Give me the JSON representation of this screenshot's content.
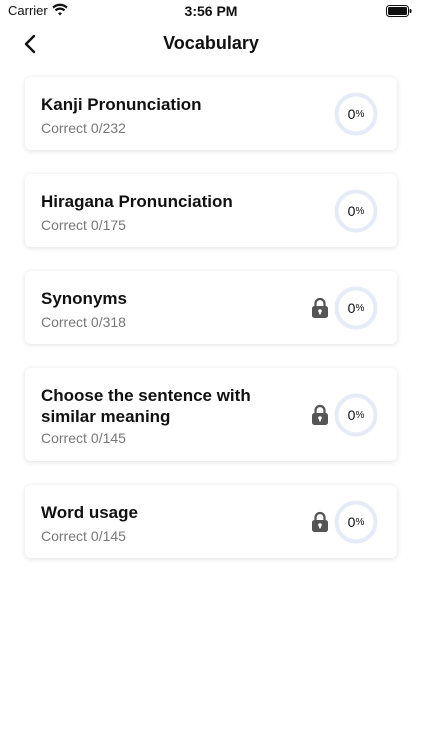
{
  "status_bar": {
    "carrier": "Carrier",
    "time": "3:56 PM"
  },
  "nav": {
    "title": "Vocabulary"
  },
  "sections": [
    {
      "title": "Kanji Pronunciation",
      "correct_label": "Correct",
      "count": "0/232",
      "progress_value": "0",
      "percent_sign": "%",
      "progress": 0,
      "locked": false
    },
    {
      "title": "Hiragana Pronunciation",
      "correct_label": "Correct",
      "count": "0/175",
      "progress_value": "0",
      "percent_sign": "%",
      "progress": 0,
      "locked": false
    },
    {
      "title": "Synonyms",
      "correct_label": "Correct",
      "count": "0/318",
      "progress_value": "0",
      "percent_sign": "%",
      "progress": 0,
      "locked": true
    },
    {
      "title": "Choose the sentence with similar meaning",
      "correct_label": "Correct",
      "count": "0/145",
      "progress_value": "0",
      "percent_sign": "%",
      "progress": 0,
      "locked": true
    },
    {
      "title": "Word usage",
      "correct_label": "Correct",
      "count": "0/145",
      "progress_value": "0",
      "percent_sign": "%",
      "progress": 0,
      "locked": true
    }
  ],
  "colors": {
    "ring_track": "#e6ebf7",
    "lock": "#555555"
  }
}
